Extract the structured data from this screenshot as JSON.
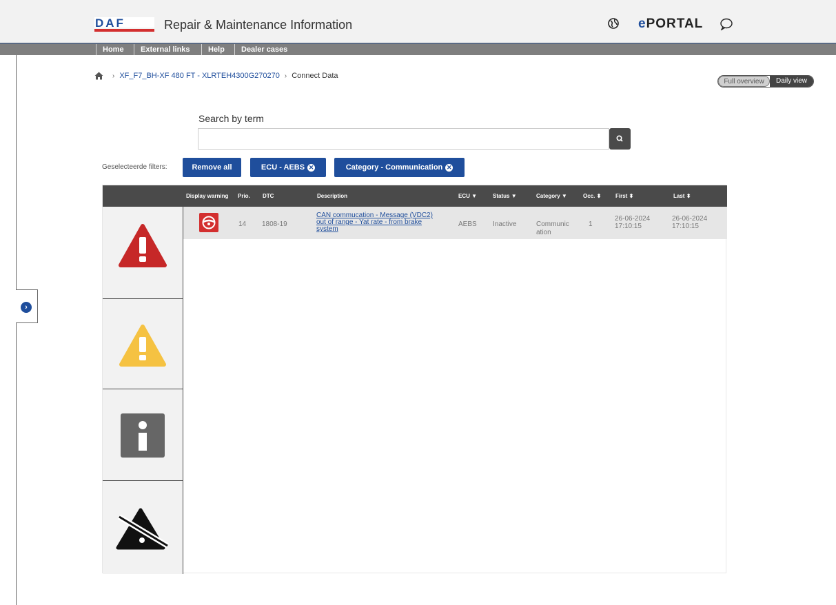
{
  "header": {
    "logo_text": "DAF",
    "app_title": "Repair & Maintenance Information",
    "portal_name_prefix": "e",
    "portal_name": "PORTAL",
    "brand_color": "#1f4e9c"
  },
  "nav": {
    "items": [
      {
        "label": "Home"
      },
      {
        "label": "External links"
      },
      {
        "label": "Help"
      },
      {
        "label": "Dealer cases"
      }
    ]
  },
  "breadcrumb": {
    "home_icon": "home-icon",
    "vehicle": "XF_F7_BH-XF 480 FT - XLRTEH4300G270270",
    "current": "Connect Data"
  },
  "view_toggle": {
    "option_full": "Full overview",
    "option_daily": "Daily view",
    "selected": "Daily view"
  },
  "search": {
    "label": "Search by term",
    "value": "",
    "placeholder": "",
    "icon": "search-icon"
  },
  "filters": {
    "label": "Geselecteerde filters:",
    "remove_all": "Remove all",
    "chips": [
      {
        "label": "ECU - AEBS"
      },
      {
        "label": "Category - Communication"
      }
    ]
  },
  "table": {
    "columns": {
      "display_warning": "Display warning",
      "prio": "Prio.",
      "dtc": "DTC",
      "description": "Description",
      "ecu": "ECU",
      "status": "Status",
      "category": "Category",
      "occ": "Occ.",
      "first": "First",
      "last": "Last"
    },
    "severity_icons": [
      "red-warning-icon",
      "yellow-warning-icon",
      "info-icon",
      "no-warning-icon"
    ],
    "rows": [
      {
        "warning_icon": "steering-wheel-warning-icon",
        "prio": "14",
        "dtc": "1808-19",
        "description_lines": [
          "CAN commucation - Message (VDC2)",
          "out of range - Yat rate - from brake",
          "system"
        ],
        "ecu": "AEBS",
        "status": "Inactive",
        "category_lines": [
          "Communic",
          "ation"
        ],
        "occ": "1",
        "first_date": "26-06-2024",
        "first_time": "17:10:15",
        "last_date": "26-06-2024",
        "last_time": "17:10:15"
      }
    ]
  }
}
